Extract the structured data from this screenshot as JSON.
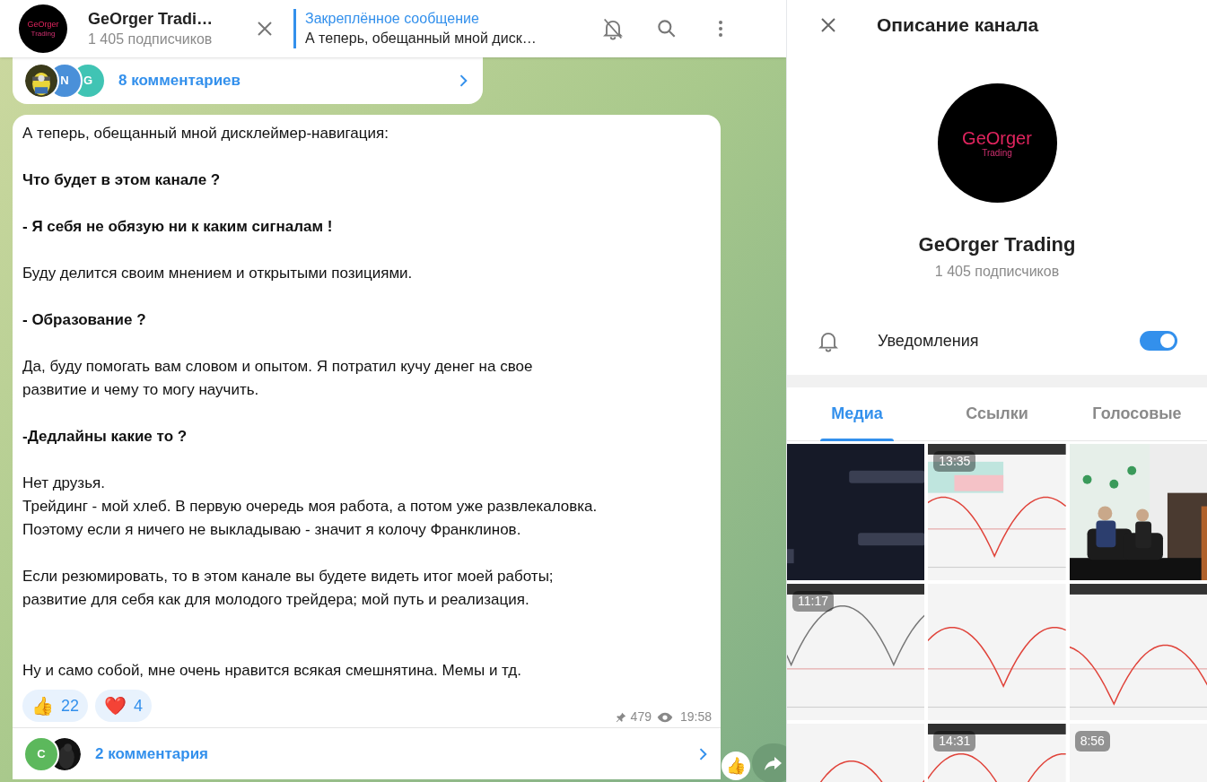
{
  "chat_header": {
    "title": "GeOrger Tradi…",
    "subtitle": "1 405 подписчиков",
    "avatar_text": "GeOrger",
    "avatar_subtext": "Trading"
  },
  "pinned": {
    "title": "Закреплённое сообщение",
    "text": "А теперь, обещанный мной диск…"
  },
  "previous_message": {
    "comments": {
      "avatars": [
        {
          "kind": "picture"
        },
        {
          "kind": "letter",
          "text": "N",
          "color": "#4a90d9"
        },
        {
          "kind": "letter",
          "text": "G",
          "color": "#40c4b4"
        }
      ],
      "label": "8 комментариев"
    }
  },
  "message": {
    "paragraphs": [
      {
        "lines": [
          "А теперь, обещанный мной дисклеймер-навигация:"
        ],
        "bold": false
      },
      {
        "lines": [
          "Что будет в этом канале ?"
        ],
        "bold": true
      },
      {
        "lines": [
          "- Я себя не обязую ни к каким сигналам !"
        ],
        "bold": true
      },
      {
        "lines": [
          "Буду делится своим мнением и открытыми позициями."
        ],
        "bold": false
      },
      {
        "lines": [
          "- Образование ?"
        ],
        "bold": true
      },
      {
        "lines": [
          "Да, буду помогать вам словом и опытом. Я потратил кучу денег на свое",
          "развитие и чему то могу научить."
        ],
        "bold": false
      },
      {
        "lines": [
          "-Дедлайны какие то ?"
        ],
        "bold": true
      },
      {
        "lines": [
          "Нет друзья.",
          "Трейдинг - мой хлеб. В первую очередь моя работа, а потом уже развлекаловка.",
          "Поэтому если я ничего не выкладываю - значит я колочу Франклинов."
        ],
        "bold": false
      },
      {
        "lines": [
          "Если резюмировать, то в этом канале вы будете видеть итог моей работы;",
          "развитие для себя как для молодого трейдера; мой путь и реализация."
        ],
        "bold": false
      },
      {
        "lines": [
          "Ну и само собой, мне очень нравится всякая смешнятина. Мемы и тд."
        ],
        "bold": false
      }
    ],
    "reactions": [
      {
        "emoji": "👍",
        "count": "22"
      },
      {
        "emoji": "❤️",
        "count": "4"
      }
    ],
    "views": "479",
    "time": "19:58",
    "comments": {
      "avatars": [
        {
          "kind": "letter",
          "text": "C",
          "color": "#5cb85c"
        },
        {
          "kind": "picture"
        }
      ],
      "label": "2 комментария"
    }
  },
  "quick_reaction": "👍",
  "info_panel": {
    "title": "Описание канала",
    "avatar_text": "GeOrger",
    "avatar_subtext": "Trading",
    "name": "GeOrger Trading",
    "subscribers": "1 405 подписчиков",
    "notifications": {
      "label": "Уведомления",
      "on": true
    },
    "tabs": [
      {
        "label": "Медиа",
        "selected": true
      },
      {
        "label": "Ссылки",
        "selected": false
      },
      {
        "label": "Голосовые",
        "selected": false
      }
    ],
    "media": [
      {
        "kind": "picture"
      },
      {
        "kind": "picture",
        "duration": "13:35"
      },
      {
        "kind": "picture"
      },
      {
        "kind": "picture",
        "duration": "11:17"
      },
      {
        "kind": "picture"
      },
      {
        "kind": "picture"
      },
      {
        "kind": "picture"
      },
      {
        "kind": "picture",
        "duration": "14:31"
      },
      {
        "kind": "picture",
        "duration": "8:56"
      }
    ]
  }
}
